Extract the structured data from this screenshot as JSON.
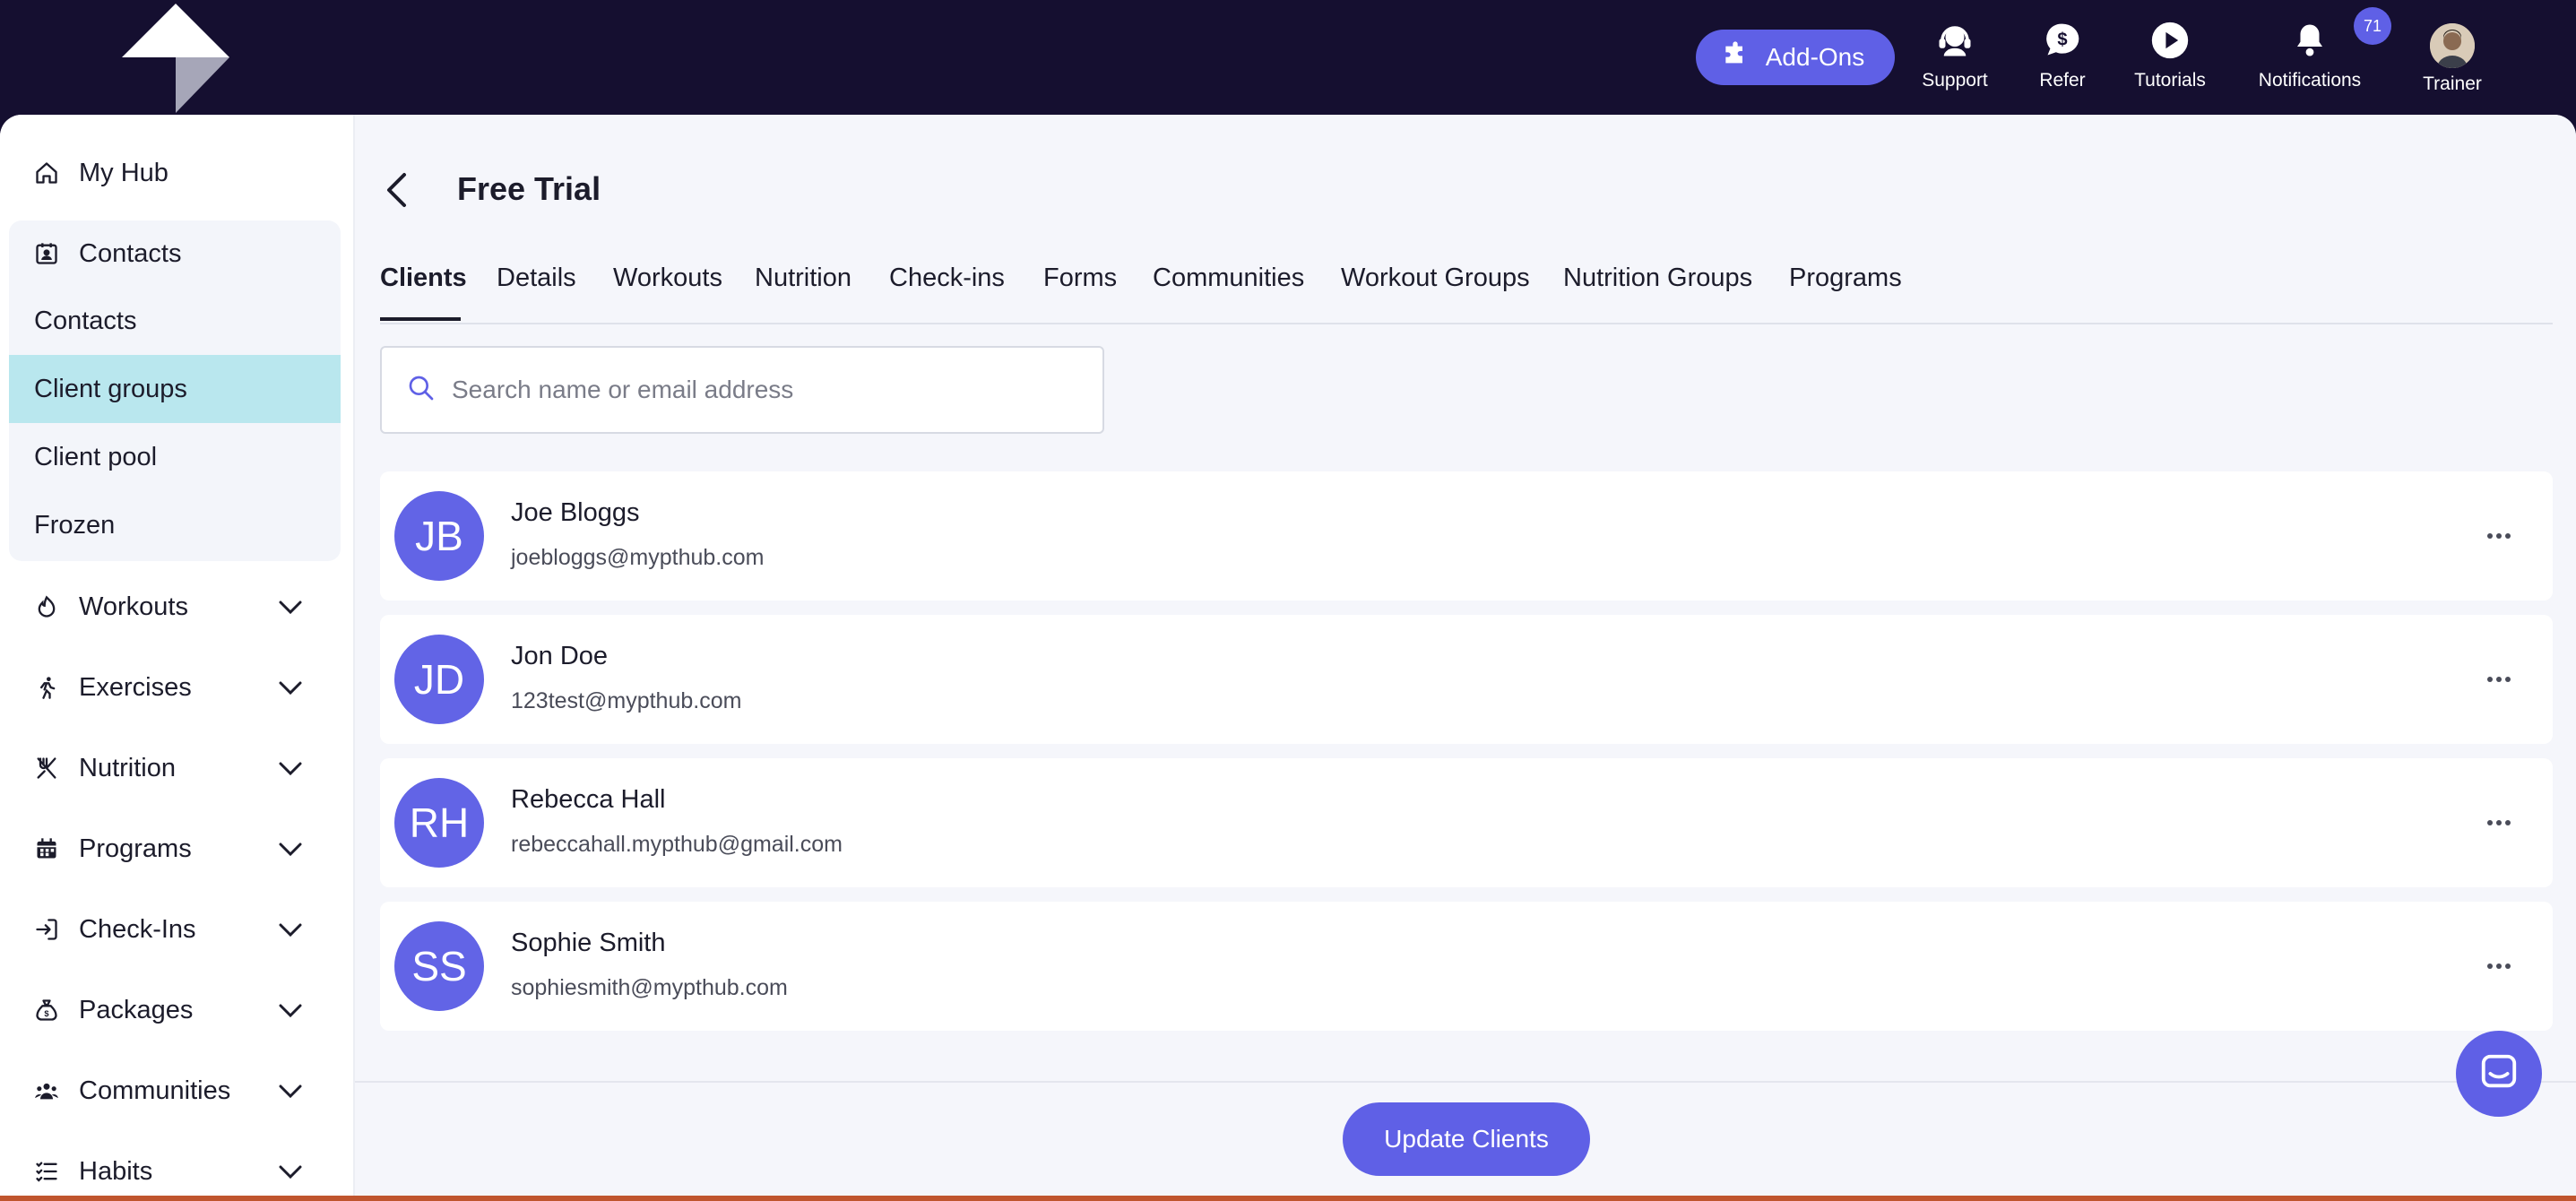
{
  "topbar": {
    "addons_label": "Add-Ons",
    "support_label": "Support",
    "refer_label": "Refer",
    "tutorials_label": "Tutorials",
    "notifications_label": "Notifications",
    "notifications_count": "71",
    "trainer_label": "Trainer"
  },
  "sidebar": {
    "my_hub": "My Hub",
    "contacts": "Contacts",
    "contacts_sub": [
      "Contacts",
      "Client groups",
      "Client pool",
      "Frozen"
    ],
    "sections": [
      "Workouts",
      "Exercises",
      "Nutrition",
      "Programs",
      "Check-Ins",
      "Packages",
      "Communities",
      "Habits"
    ]
  },
  "header": {
    "title": "Free Trial"
  },
  "tabs": [
    "Clients",
    "Details",
    "Workouts",
    "Nutrition",
    "Check-ins",
    "Forms",
    "Communities",
    "Workout Groups",
    "Nutrition Groups",
    "Programs"
  ],
  "search": {
    "placeholder": "Search name or email address"
  },
  "clients": [
    {
      "initials": "JB",
      "name": "Joe Bloggs",
      "email": "joebloggs@mypthub.com"
    },
    {
      "initials": "JD",
      "name": "Jon Doe",
      "email": "123test@mypthub.com"
    },
    {
      "initials": "RH",
      "name": "Rebecca Hall",
      "email": "rebeccahall.mypthub@gmail.com"
    },
    {
      "initials": "SS",
      "name": "Sophie Smith",
      "email": "sophiesmith@mypthub.com"
    }
  ],
  "footer": {
    "update_label": "Update Clients"
  },
  "colors": {
    "accent": "#5f60e6",
    "topbar": "#150f30",
    "active_group": "#b9e7ee"
  }
}
